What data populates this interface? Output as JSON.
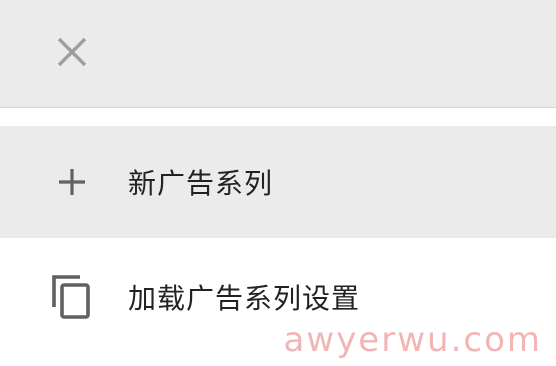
{
  "header": {
    "close_icon": "close-icon"
  },
  "menu": {
    "items": [
      {
        "icon": "plus-icon",
        "label": "新广告系列"
      },
      {
        "icon": "copy-icon",
        "label": "加载广告系列设置"
      }
    ]
  },
  "watermark": "awyerwu.com",
  "colors": {
    "header_bg": "#ebebeb",
    "highlight_bg": "#ebebeb",
    "icon_gray": "#9e9e9e",
    "icon_dark": "#616161",
    "text": "#222222",
    "watermark": "#e87878"
  }
}
